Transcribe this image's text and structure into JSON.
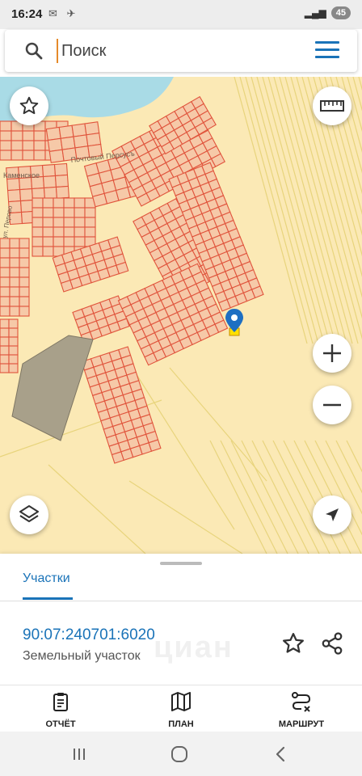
{
  "status": {
    "time": "16:24",
    "battery": "45"
  },
  "search": {
    "placeholder": "Поиск"
  },
  "map": {
    "labels": {
      "postal": "Почтовый Персусъ",
      "village": "Каменское",
      "street": "ул. Перово"
    },
    "colors": {
      "land": "#fbe9b5",
      "parcel_fill": "#f6c9a8",
      "parcel_stroke": "#e0543c",
      "water": "#a9dbe6",
      "selected": "#ffe000",
      "marker": "#1e6fc2",
      "quarry": "#a8a08a",
      "outline": "#e8d47c"
    }
  },
  "sheet": {
    "tab_label": "Участки",
    "parcel_number": "90:07:240701:6020",
    "parcel_type": "Земельный участок",
    "watermark": "циан"
  },
  "nav": {
    "report": "ОТЧЁТ",
    "plan": "ПЛАН",
    "route": "МАРШРУТ"
  }
}
